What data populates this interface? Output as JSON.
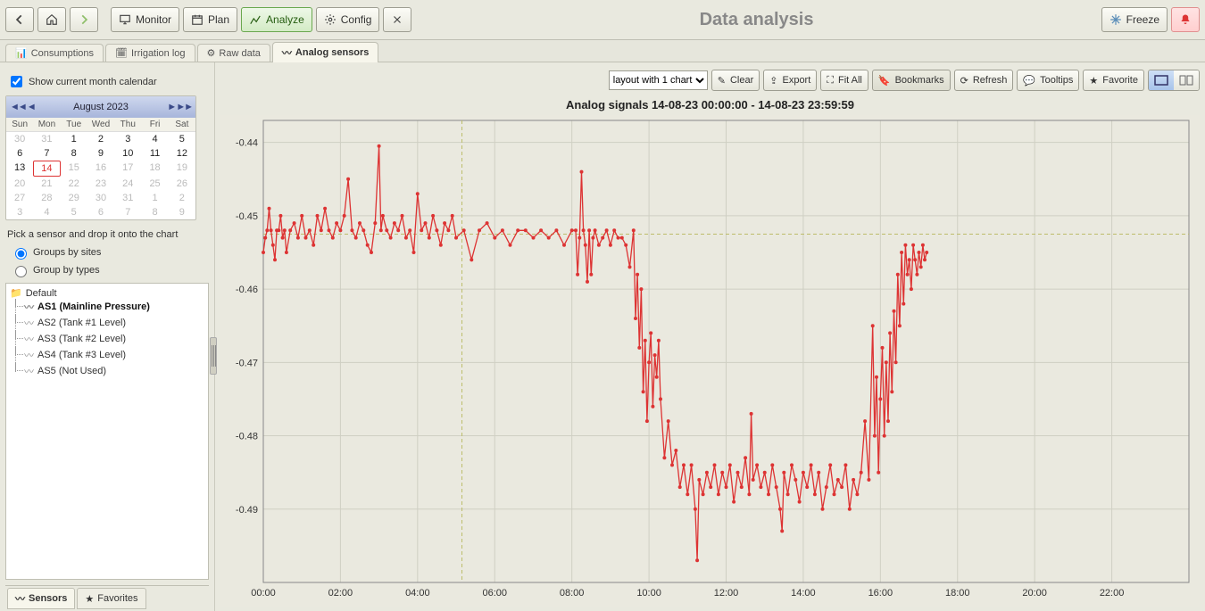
{
  "page_title": "Data analysis",
  "top_buttons": {
    "monitor": "Monitor",
    "plan": "Plan",
    "analyze": "Analyze",
    "config": "Config",
    "freeze": "Freeze"
  },
  "tabs": [
    {
      "id": "consumptions",
      "label": "Consumptions",
      "active": false
    },
    {
      "id": "irrigation",
      "label": "Irrigation log",
      "active": false
    },
    {
      "id": "raw",
      "label": "Raw data",
      "active": false
    },
    {
      "id": "analog",
      "label": "Analog sensors",
      "active": true
    }
  ],
  "sidebar": {
    "show_calendar_label": "Show current month calendar",
    "cal_title": "August  2023",
    "dow": [
      "Sun",
      "Mon",
      "Tue",
      "Wed",
      "Thu",
      "Fri",
      "Sat"
    ],
    "days": [
      {
        "n": 30,
        "out": true
      },
      {
        "n": 31,
        "out": true
      },
      {
        "n": 1
      },
      {
        "n": 2
      },
      {
        "n": 3
      },
      {
        "n": 4
      },
      {
        "n": 5
      },
      {
        "n": 6
      },
      {
        "n": 7
      },
      {
        "n": 8
      },
      {
        "n": 9
      },
      {
        "n": 10
      },
      {
        "n": 11
      },
      {
        "n": 12
      },
      {
        "n": 13
      },
      {
        "n": 14,
        "sel": true
      },
      {
        "n": 15,
        "out": true
      },
      {
        "n": 16,
        "out": true
      },
      {
        "n": 17,
        "out": true
      },
      {
        "n": 18,
        "out": true
      },
      {
        "n": 19,
        "out": true
      },
      {
        "n": 20,
        "out": true
      },
      {
        "n": 21,
        "out": true
      },
      {
        "n": 22,
        "out": true
      },
      {
        "n": 23,
        "out": true
      },
      {
        "n": 24,
        "out": true
      },
      {
        "n": 25,
        "out": true
      },
      {
        "n": 26,
        "out": true
      },
      {
        "n": 27,
        "out": true
      },
      {
        "n": 28,
        "out": true
      },
      {
        "n": 29,
        "out": true
      },
      {
        "n": 30,
        "out": true
      },
      {
        "n": 31,
        "out": true
      },
      {
        "n": 1,
        "out": true
      },
      {
        "n": 2,
        "out": true
      },
      {
        "n": 3,
        "out": true
      },
      {
        "n": 4,
        "out": true
      },
      {
        "n": 5,
        "out": true
      },
      {
        "n": 6,
        "out": true
      },
      {
        "n": 7,
        "out": true
      },
      {
        "n": 8,
        "out": true
      },
      {
        "n": 9,
        "out": true
      }
    ],
    "pick_label": "Pick a sensor and drop it onto the chart",
    "group_sites": "Groups by sites",
    "group_types": "Group by types",
    "folder": "Default",
    "sensors": [
      {
        "label": "AS1 (Mainline Pressure)",
        "sel": true
      },
      {
        "label": "AS2 (Tank #1 Level)"
      },
      {
        "label": "AS3 (Tank #2 Level)"
      },
      {
        "label": "AS4 (Tank #3 Level)"
      },
      {
        "label": "AS5 (Not Used)"
      }
    ],
    "side_tabs": {
      "sensors": "Sensors",
      "favorites": "Favorites"
    }
  },
  "main_toolbar": {
    "layout_select": "layout with 1 chart",
    "clear": "Clear",
    "export": "Export",
    "fitall": "Fit All",
    "bookmarks": "Bookmarks",
    "refresh": "Refresh",
    "tooltips": "Tooltips",
    "favorite": "Favorite"
  },
  "chart_title": "Analog signals 14-08-23 00:00:00 - 14-08-23 23:59:59",
  "chart_data": {
    "type": "line",
    "title": "Analog signals 14-08-23 00:00:00 - 14-08-23 23:59:59",
    "xlabel": "",
    "ylabel": "",
    "ylim": [
      -0.5,
      -0.437
    ],
    "xlim_hours": [
      0,
      24
    ],
    "xticks": [
      "00:00",
      "02:00",
      "04:00",
      "06:00",
      "08:00",
      "10:00",
      "12:00",
      "14:00",
      "16:00",
      "18:00",
      "20:00",
      "22:00"
    ],
    "yticks": [
      -0.44,
      -0.45,
      -0.46,
      -0.47,
      -0.48,
      -0.49
    ],
    "reference_y": -0.4525,
    "reference_x_hour": 5.15,
    "series": [
      {
        "name": "AS1",
        "unit": "",
        "color": "#d33",
        "points": [
          [
            0.0,
            -0.455
          ],
          [
            0.05,
            -0.453
          ],
          [
            0.1,
            -0.452
          ],
          [
            0.15,
            -0.449
          ],
          [
            0.2,
            -0.452
          ],
          [
            0.25,
            -0.454
          ],
          [
            0.3,
            -0.456
          ],
          [
            0.35,
            -0.452
          ],
          [
            0.4,
            -0.452
          ],
          [
            0.45,
            -0.45
          ],
          [
            0.5,
            -0.453
          ],
          [
            0.55,
            -0.452
          ],
          [
            0.6,
            -0.455
          ],
          [
            0.7,
            -0.452
          ],
          [
            0.8,
            -0.451
          ],
          [
            0.9,
            -0.453
          ],
          [
            1.0,
            -0.45
          ],
          [
            1.1,
            -0.453
          ],
          [
            1.2,
            -0.452
          ],
          [
            1.3,
            -0.454
          ],
          [
            1.4,
            -0.45
          ],
          [
            1.5,
            -0.452
          ],
          [
            1.6,
            -0.449
          ],
          [
            1.7,
            -0.452
          ],
          [
            1.8,
            -0.453
          ],
          [
            1.9,
            -0.451
          ],
          [
            2.0,
            -0.452
          ],
          [
            2.1,
            -0.45
          ],
          [
            2.2,
            -0.445
          ],
          [
            2.3,
            -0.452
          ],
          [
            2.4,
            -0.453
          ],
          [
            2.5,
            -0.451
          ],
          [
            2.6,
            -0.452
          ],
          [
            2.7,
            -0.454
          ],
          [
            2.8,
            -0.455
          ],
          [
            2.9,
            -0.451
          ],
          [
            3.0,
            -0.4405
          ],
          [
            3.05,
            -0.452
          ],
          [
            3.1,
            -0.45
          ],
          [
            3.2,
            -0.452
          ],
          [
            3.3,
            -0.453
          ],
          [
            3.4,
            -0.451
          ],
          [
            3.5,
            -0.452
          ],
          [
            3.6,
            -0.45
          ],
          [
            3.7,
            -0.453
          ],
          [
            3.8,
            -0.452
          ],
          [
            3.9,
            -0.455
          ],
          [
            4.0,
            -0.447
          ],
          [
            4.1,
            -0.452
          ],
          [
            4.2,
            -0.451
          ],
          [
            4.3,
            -0.453
          ],
          [
            4.4,
            -0.45
          ],
          [
            4.5,
            -0.452
          ],
          [
            4.6,
            -0.454
          ],
          [
            4.7,
            -0.451
          ],
          [
            4.8,
            -0.452
          ],
          [
            4.9,
            -0.45
          ],
          [
            5.0,
            -0.453
          ],
          [
            5.2,
            -0.452
          ],
          [
            5.4,
            -0.456
          ],
          [
            5.6,
            -0.452
          ],
          [
            5.8,
            -0.451
          ],
          [
            6.0,
            -0.453
          ],
          [
            6.2,
            -0.452
          ],
          [
            6.4,
            -0.454
          ],
          [
            6.6,
            -0.452
          ],
          [
            6.8,
            -0.452
          ],
          [
            7.0,
            -0.453
          ],
          [
            7.2,
            -0.452
          ],
          [
            7.4,
            -0.453
          ],
          [
            7.6,
            -0.452
          ],
          [
            7.8,
            -0.454
          ],
          [
            8.0,
            -0.452
          ],
          [
            8.1,
            -0.452
          ],
          [
            8.15,
            -0.458
          ],
          [
            8.2,
            -0.453
          ],
          [
            8.25,
            -0.444
          ],
          [
            8.3,
            -0.452
          ],
          [
            8.35,
            -0.454
          ],
          [
            8.4,
            -0.459
          ],
          [
            8.45,
            -0.452
          ],
          [
            8.5,
            -0.458
          ],
          [
            8.55,
            -0.453
          ],
          [
            8.6,
            -0.452
          ],
          [
            8.7,
            -0.454
          ],
          [
            8.8,
            -0.453
          ],
          [
            8.9,
            -0.452
          ],
          [
            9.0,
            -0.454
          ],
          [
            9.1,
            -0.452
          ],
          [
            9.2,
            -0.453
          ],
          [
            9.3,
            -0.453
          ],
          [
            9.4,
            -0.454
          ],
          [
            9.5,
            -0.457
          ],
          [
            9.6,
            -0.452
          ],
          [
            9.65,
            -0.464
          ],
          [
            9.7,
            -0.458
          ],
          [
            9.75,
            -0.468
          ],
          [
            9.8,
            -0.46
          ],
          [
            9.85,
            -0.474
          ],
          [
            9.9,
            -0.467
          ],
          [
            9.95,
            -0.478
          ],
          [
            10.0,
            -0.47
          ],
          [
            10.05,
            -0.466
          ],
          [
            10.1,
            -0.476
          ],
          [
            10.15,
            -0.469
          ],
          [
            10.2,
            -0.472
          ],
          [
            10.25,
            -0.467
          ],
          [
            10.3,
            -0.475
          ],
          [
            10.4,
            -0.483
          ],
          [
            10.5,
            -0.478
          ],
          [
            10.6,
            -0.484
          ],
          [
            10.7,
            -0.482
          ],
          [
            10.8,
            -0.487
          ],
          [
            10.9,
            -0.484
          ],
          [
            11.0,
            -0.488
          ],
          [
            11.1,
            -0.484
          ],
          [
            11.2,
            -0.49
          ],
          [
            11.25,
            -0.497
          ],
          [
            11.3,
            -0.486
          ],
          [
            11.4,
            -0.488
          ],
          [
            11.5,
            -0.485
          ],
          [
            11.6,
            -0.487
          ],
          [
            11.7,
            -0.484
          ],
          [
            11.8,
            -0.488
          ],
          [
            11.9,
            -0.485
          ],
          [
            12.0,
            -0.487
          ],
          [
            12.1,
            -0.484
          ],
          [
            12.2,
            -0.489
          ],
          [
            12.3,
            -0.485
          ],
          [
            12.4,
            -0.487
          ],
          [
            12.5,
            -0.483
          ],
          [
            12.6,
            -0.488
          ],
          [
            12.65,
            -0.477
          ],
          [
            12.7,
            -0.486
          ],
          [
            12.8,
            -0.484
          ],
          [
            12.9,
            -0.487
          ],
          [
            13.0,
            -0.485
          ],
          [
            13.1,
            -0.488
          ],
          [
            13.2,
            -0.484
          ],
          [
            13.3,
            -0.487
          ],
          [
            13.4,
            -0.49
          ],
          [
            13.45,
            -0.493
          ],
          [
            13.5,
            -0.485
          ],
          [
            13.6,
            -0.488
          ],
          [
            13.7,
            -0.484
          ],
          [
            13.8,
            -0.486
          ],
          [
            13.9,
            -0.489
          ],
          [
            14.0,
            -0.485
          ],
          [
            14.1,
            -0.487
          ],
          [
            14.2,
            -0.484
          ],
          [
            14.3,
            -0.488
          ],
          [
            14.4,
            -0.485
          ],
          [
            14.5,
            -0.49
          ],
          [
            14.6,
            -0.487
          ],
          [
            14.7,
            -0.484
          ],
          [
            14.8,
            -0.488
          ],
          [
            14.9,
            -0.486
          ],
          [
            15.0,
            -0.487
          ],
          [
            15.1,
            -0.484
          ],
          [
            15.2,
            -0.49
          ],
          [
            15.3,
            -0.486
          ],
          [
            15.4,
            -0.488
          ],
          [
            15.5,
            -0.485
          ],
          [
            15.6,
            -0.478
          ],
          [
            15.7,
            -0.486
          ],
          [
            15.8,
            -0.465
          ],
          [
            15.85,
            -0.48
          ],
          [
            15.9,
            -0.472
          ],
          [
            15.95,
            -0.485
          ],
          [
            16.0,
            -0.475
          ],
          [
            16.05,
            -0.468
          ],
          [
            16.1,
            -0.48
          ],
          [
            16.15,
            -0.47
          ],
          [
            16.2,
            -0.478
          ],
          [
            16.25,
            -0.466
          ],
          [
            16.3,
            -0.474
          ],
          [
            16.35,
            -0.463
          ],
          [
            16.4,
            -0.47
          ],
          [
            16.45,
            -0.458
          ],
          [
            16.5,
            -0.465
          ],
          [
            16.55,
            -0.455
          ],
          [
            16.6,
            -0.462
          ],
          [
            16.65,
            -0.454
          ],
          [
            16.7,
            -0.458
          ],
          [
            16.75,
            -0.456
          ],
          [
            16.8,
            -0.46
          ],
          [
            16.85,
            -0.454
          ],
          [
            16.9,
            -0.456
          ],
          [
            16.95,
            -0.458
          ],
          [
            17.0,
            -0.455
          ],
          [
            17.05,
            -0.457
          ],
          [
            17.1,
            -0.454
          ],
          [
            17.15,
            -0.456
          ],
          [
            17.2,
            -0.455
          ]
        ]
      }
    ]
  }
}
